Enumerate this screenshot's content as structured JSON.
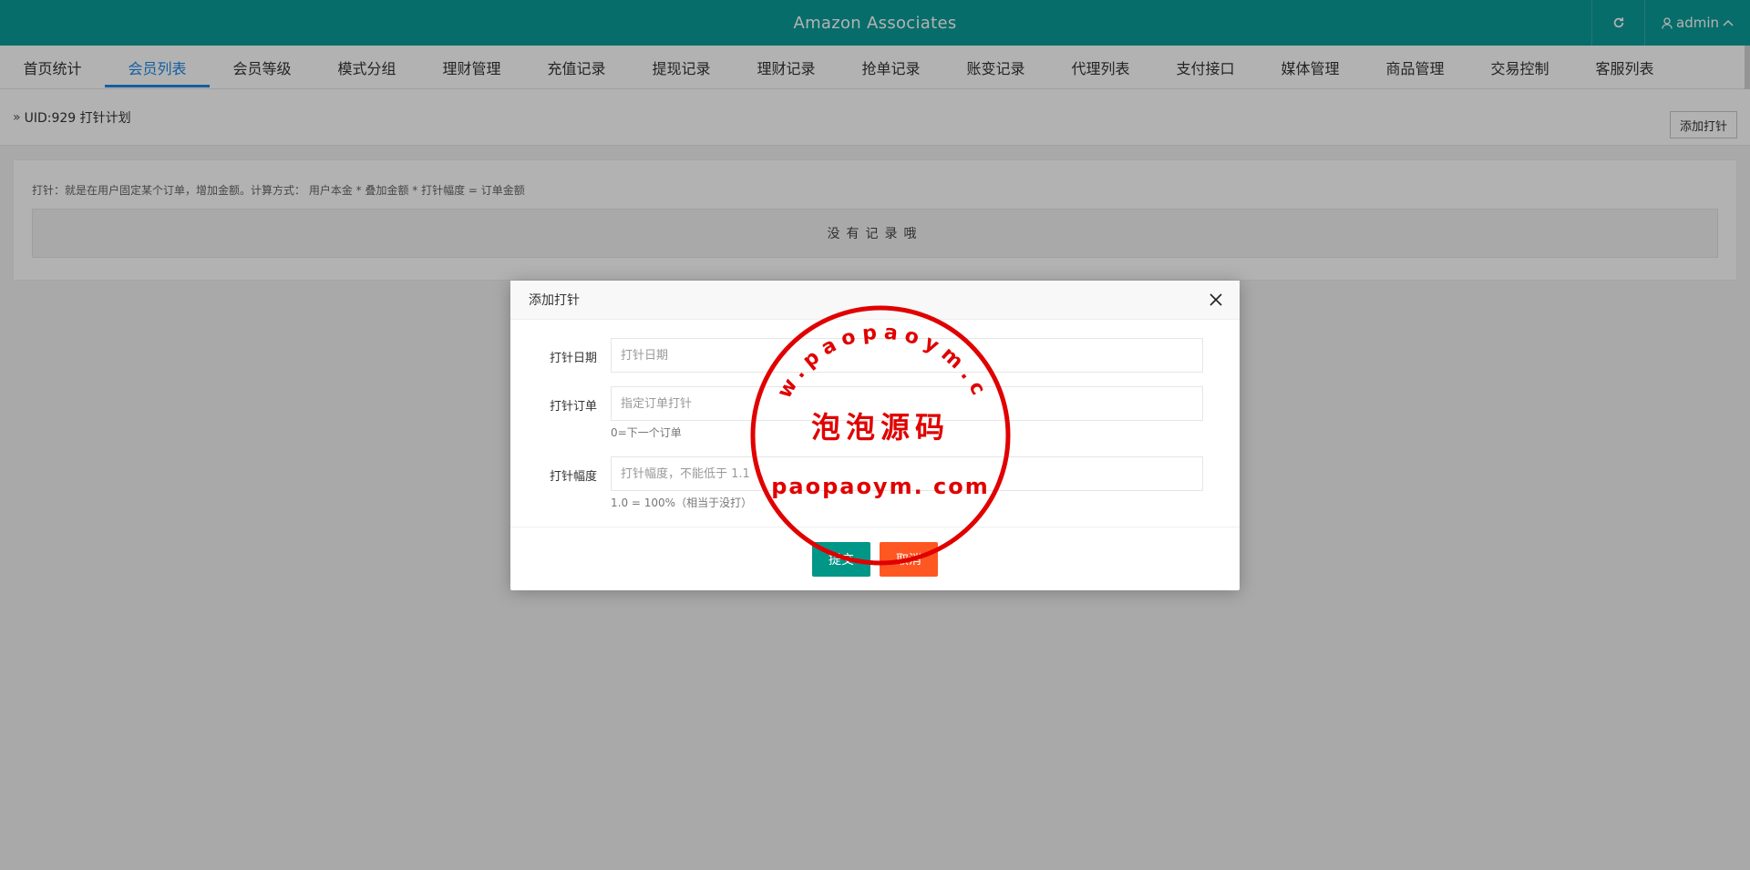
{
  "header": {
    "title": "Amazon Associates",
    "user": "admin",
    "icons": {
      "refresh": "refresh-icon",
      "user": "user-icon",
      "caret": "chevron-up-icon"
    },
    "brand_color": "#0b9c98"
  },
  "nav": {
    "active": "会员列表",
    "items": [
      {
        "label": "首页统计"
      },
      {
        "label": "会员列表"
      },
      {
        "label": "会员等级"
      },
      {
        "label": "模式分组"
      },
      {
        "label": "理财管理"
      },
      {
        "label": "充值记录"
      },
      {
        "label": "提现记录"
      },
      {
        "label": "理财记录"
      },
      {
        "label": "抢单记录"
      },
      {
        "label": "账变记录"
      },
      {
        "label": "代理列表"
      },
      {
        "label": "支付接口"
      },
      {
        "label": "媒体管理"
      },
      {
        "label": "商品管理"
      },
      {
        "label": "交易控制"
      },
      {
        "label": "客服列表"
      }
    ]
  },
  "breadcrumb": {
    "text": "UID:929 打针计划",
    "add_button": "添加打针"
  },
  "card": {
    "tip": "打针：就是在用户固定某个订单，增加金额。计算方式： 用户本金 * 叠加金额 * 打针幅度 = 订单金额",
    "empty": "没有记录哦"
  },
  "modal": {
    "title": "添加打针",
    "fields": [
      {
        "label": "打针日期",
        "placeholder": "打针日期",
        "hint": ""
      },
      {
        "label": "打针订单",
        "placeholder": "指定订单打针",
        "hint": "0=下一个订单"
      },
      {
        "label": "打针幅度",
        "placeholder": "打针幅度，不能低于 1.1",
        "hint": "1.0 = 100%（相当于没打）"
      }
    ],
    "submit": "提交",
    "cancel": "取消"
  },
  "watermark": {
    "arc_text": "www.paopaoym.com",
    "center_text": "泡泡源码",
    "bottom_text": "paopaoym. com",
    "color": "#e00000"
  }
}
